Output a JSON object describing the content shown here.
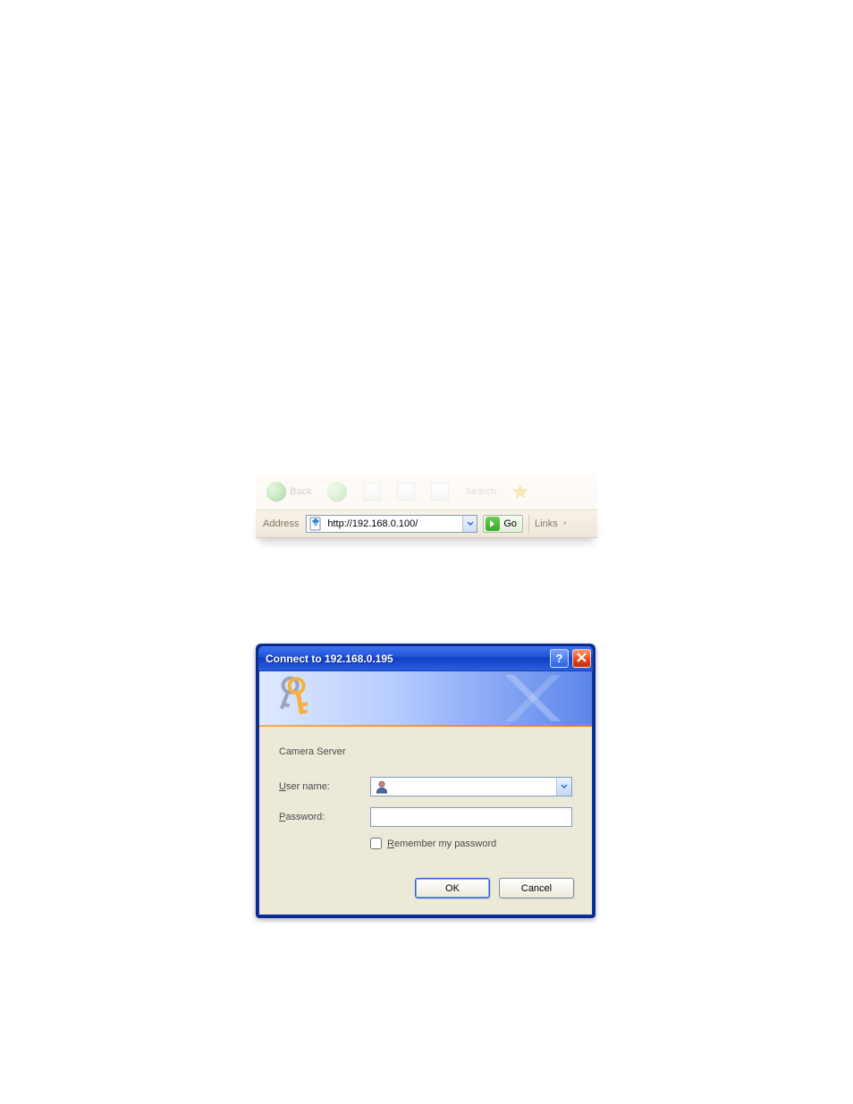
{
  "toolbar_faded": {
    "back_label": "Back",
    "search_label": "Search"
  },
  "address_bar": {
    "label": "Address",
    "url_value": "http://192.168.0.100/",
    "go_label": "Go",
    "links_label": "Links"
  },
  "dialog": {
    "title": "Connect to 192.168.0.195",
    "server_label": "Camera Server",
    "username_label_pre": "U",
    "username_label_rest": "ser name:",
    "username_value": "",
    "password_label_pre": "P",
    "password_label_rest": "assword:",
    "password_value": "",
    "remember_pre": "R",
    "remember_rest": "emember my password",
    "ok_label": "OK",
    "cancel_label": "Cancel"
  }
}
